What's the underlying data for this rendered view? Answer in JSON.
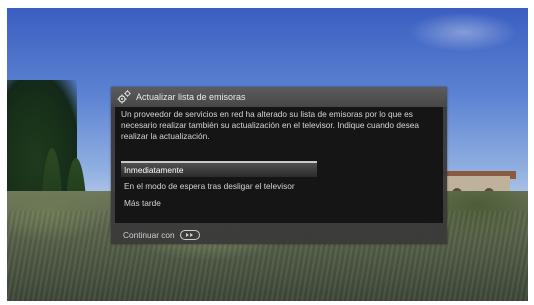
{
  "dialog": {
    "title": "Actualizar lista de emisoras",
    "message": "Un proveedor de servicios en red ha alterado su lista de emisoras por lo que es necesario realizar también su actualización en el televisor. Indique cuando desea realizar la actualización.",
    "options": [
      {
        "label": "Inmediatamente",
        "selected": true
      },
      {
        "label": "En el modo de espera tras desligar el televisor",
        "selected": false
      },
      {
        "label": "Más tarde",
        "selected": false
      }
    ],
    "footer": {
      "label": "Continuar con",
      "key_icon": "ok-button-icon"
    },
    "header_icon": "settings-gears-icon"
  },
  "colors": {
    "dialog_bg": "#3a3a3a",
    "body_bg": "#151515",
    "text": "#d6d6d6",
    "selected_text": "#ffffff"
  }
}
